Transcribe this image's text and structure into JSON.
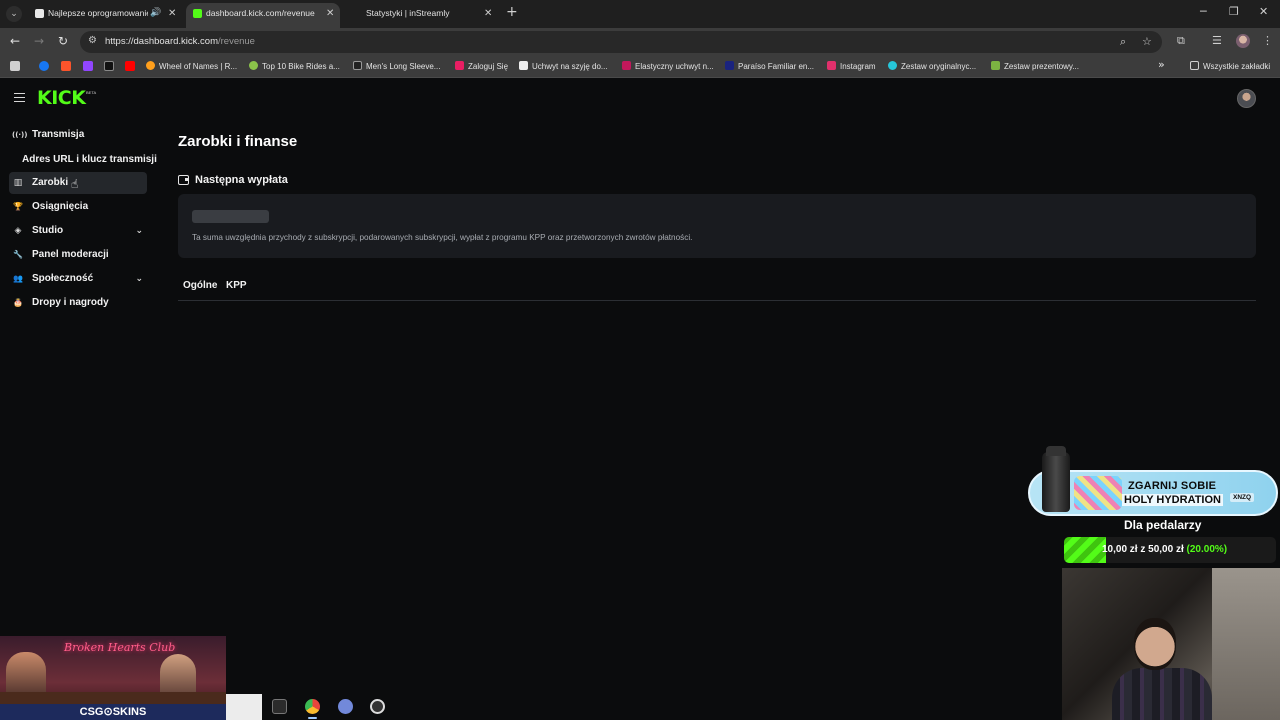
{
  "browser": {
    "tabs": [
      {
        "title": "Najlepsze oprogramowanie",
        "favicon_color": "#e8e8e8",
        "active": false
      },
      {
        "title": "dashboard.kick.com/revenue",
        "favicon_color": "#53fc18",
        "active": true
      },
      {
        "title": "Statystyki | inStreamly",
        "favicon_color": "#5b6cff",
        "active": false
      }
    ],
    "icons": {
      "tab_menu": "chevron-down-icon",
      "audio": "speaker-icon",
      "close": "close-icon",
      "new_tab": "plus-icon",
      "minimize": "minimize-icon",
      "restore": "restore-icon",
      "close_window": "close-icon"
    },
    "glyphs": {
      "tab_menu": "⌄",
      "audio": "🔊",
      "close": "✕",
      "new_tab": "+",
      "minimize": "─",
      "restore": "❐",
      "close_window": "✕",
      "back": "←",
      "forward": "→",
      "reload": "↻",
      "site_info": "⚙",
      "zoom": "⌕",
      "star": "☆",
      "extensions": "⧉",
      "media": "☰",
      "menu": "⋮",
      "chevron_more": "»",
      "folder": "🗀"
    },
    "url": {
      "host": "https://dashboard.kick.com",
      "path": "/revenue"
    },
    "bookmarks": [
      {
        "label": "Wheel of Names | R...",
        "color": "#ff9f1c"
      },
      {
        "label": "Top 10 Bike Rides a...",
        "color": "#8bc34a"
      },
      {
        "label": "Men's Long Sleeve...",
        "color": "#222222"
      },
      {
        "label": "Zaloguj Się",
        "color": "#e91e63"
      },
      {
        "label": "Uchwyt na szyję do...",
        "color": "#eeeeee"
      },
      {
        "label": "Elastyczny uchwyt n...",
        "color": "#c2185b"
      },
      {
        "label": "Paraíso Familiar en...",
        "color": "#1a237e"
      },
      {
        "label": "Instagram",
        "color": "#e1306c"
      },
      {
        "label": "Zestaw oryginalnyc...",
        "color": "#26c6da"
      },
      {
        "label": "Zestaw prezentowy...",
        "color": "#7cb342"
      }
    ],
    "bookmark_icons": [
      {
        "name": "apps-icon",
        "color": "#d0d0d0"
      },
      {
        "name": "facebook-icon",
        "color": "#1877f2"
      },
      {
        "name": "brave-icon",
        "color": "#fb542b"
      },
      {
        "name": "twitch-icon",
        "color": "#9146ff"
      },
      {
        "name": "x-icon",
        "color": "#111111"
      },
      {
        "name": "youtube-icon",
        "color": "#ff0000"
      }
    ],
    "all_bookmarks": "Wszystkie zakładki"
  },
  "kick": {
    "brand_color": "#53fc18",
    "logo_text": "KICK",
    "logo_badge": "BETA",
    "sidebar": {
      "items": [
        {
          "label": "Transmisja",
          "icon": "broadcast-icon",
          "glyph": "((·))"
        },
        {
          "label": "Zarobki",
          "icon": "chart-bar-icon",
          "glyph": "▥",
          "active": true
        },
        {
          "label": "Osiągnięcia",
          "icon": "trophy-icon",
          "glyph": "🏆"
        },
        {
          "label": "Studio",
          "icon": "layers-icon",
          "glyph": "◈",
          "expandable": true
        },
        {
          "label": "Panel moderacji",
          "icon": "wrench-icon",
          "glyph": "🔧"
        },
        {
          "label": "Społeczność",
          "icon": "users-icon",
          "glyph": "👥",
          "expandable": true
        },
        {
          "label": "Dropy i nagrody",
          "icon": "gift-icon",
          "glyph": "🎂"
        }
      ],
      "sub_item": "Adres URL i klucz transmisji",
      "chevron_glyph": "⌄"
    },
    "main": {
      "title": "Zarobki i finanse",
      "next_payout_title": "Następna wypłata",
      "payout_note": "Ta suma uwzględnia przychody z subskrypcji, podarowanych subskrypcji, wypłat z programu KPP oraz przetworzonych zwrotów płatności.",
      "tabs": [
        "Ogólne",
        "KPP"
      ]
    }
  },
  "overlay": {
    "promo": {
      "line1": "ZGARNIJ SOBIE",
      "line2": "HOLY HYDRATION",
      "code": "XNZQ"
    },
    "goal": {
      "title": "Dla pedalarzy",
      "current": "10,00 zł",
      "separator": "z",
      "target": "50,00 zł",
      "percent_text": "(20.00%)",
      "fraction": 0.2
    },
    "sponsor": {
      "neon": "Broken Hearts Club",
      "brand": "CSG⊙SKINS"
    }
  },
  "taskbar": [
    {
      "name": "terminal-icon",
      "color": "#2b2b2b"
    },
    {
      "name": "chrome-icon",
      "color": "#e8453c"
    },
    {
      "name": "discord-icon",
      "color": "#7289da"
    },
    {
      "name": "obs-icon",
      "color": "#333333"
    }
  ]
}
